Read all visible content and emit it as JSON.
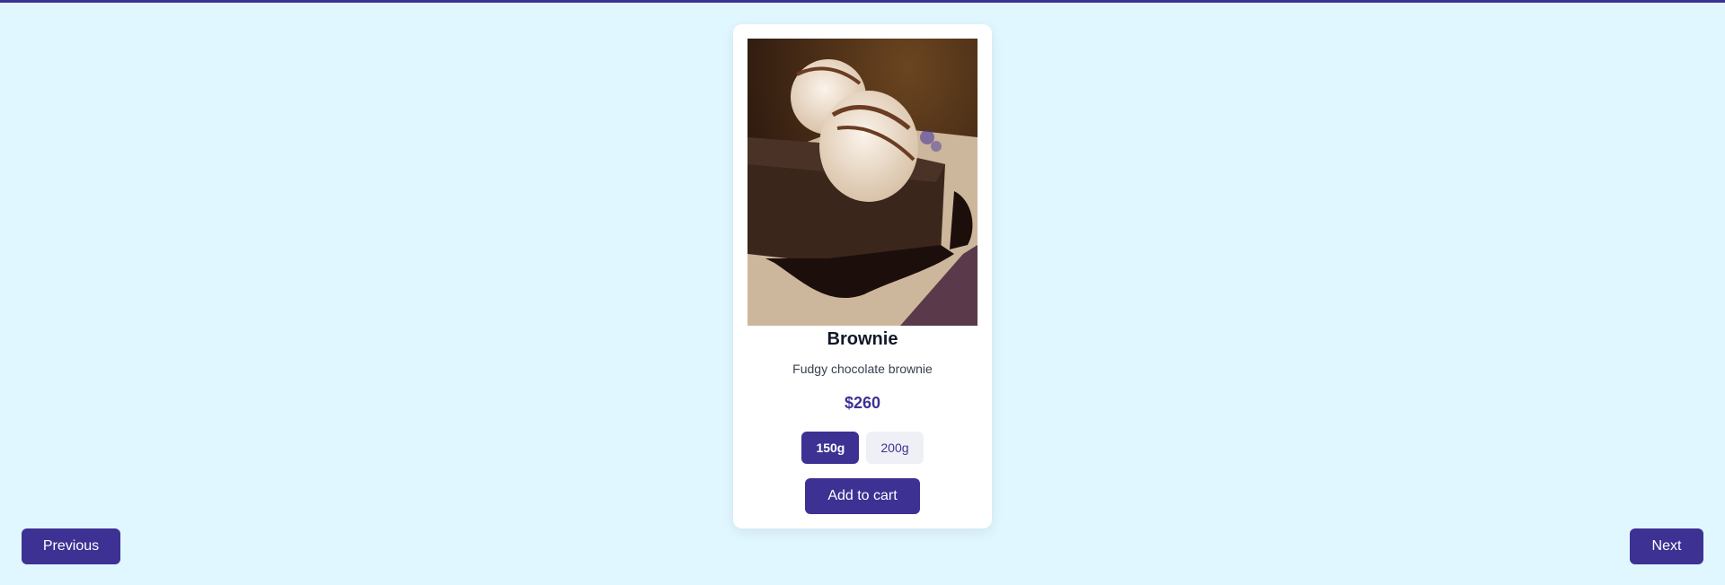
{
  "product": {
    "title": "Brownie",
    "description": "Fudgy chocolate brownie",
    "price": "$260",
    "image_icon": "brownie-with-ice-cream-photo",
    "variants": [
      {
        "label": "150g",
        "selected": true
      },
      {
        "label": "200g",
        "selected": false
      }
    ],
    "add_to_cart_label": "Add to cart"
  },
  "navigation": {
    "previous_label": "Previous",
    "next_label": "Next"
  },
  "colors": {
    "accent": "#3d3293",
    "background": "#e1f7ff",
    "card": "#ffffff"
  }
}
